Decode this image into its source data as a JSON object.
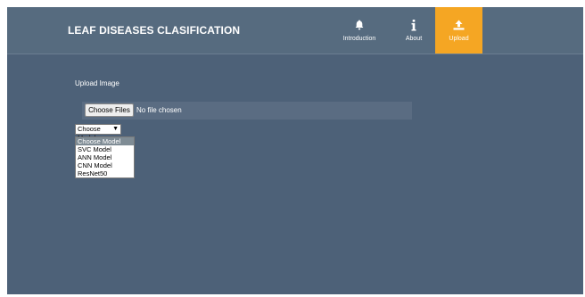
{
  "header": {
    "brand": "LEAF DISEASES CLASIFICATION",
    "nav": [
      {
        "label": "Introduction",
        "icon": "bell-icon"
      },
      {
        "label": "About",
        "icon": "info-icon"
      },
      {
        "label": "Upload",
        "icon": "upload-icon",
        "active": true
      }
    ]
  },
  "colors": {
    "page_bg": "#4d6178",
    "navbar_bg": "#566b7f",
    "accent": "#f5a623"
  },
  "upload": {
    "title": "Upload Image",
    "choose_files_label": "Choose Files",
    "file_status": "No file chosen"
  },
  "model_select": {
    "selected": "Choose Model",
    "options": [
      "Choose Model",
      "SVC Model",
      "ANN Model",
      "CNN Model",
      "ResNet50"
    ]
  }
}
